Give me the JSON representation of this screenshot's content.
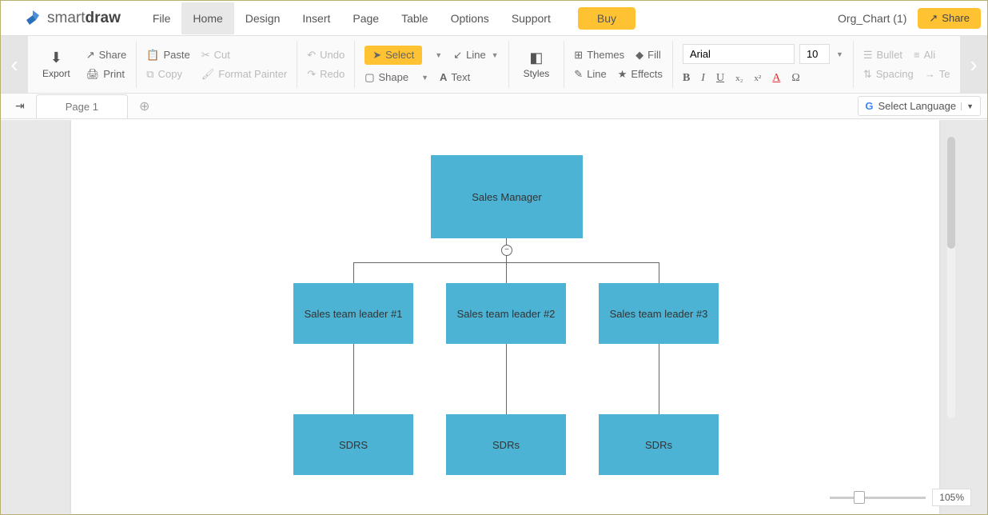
{
  "header": {
    "logo_text_light": "smart",
    "logo_text_bold": "draw",
    "menu": [
      "File",
      "Home",
      "Design",
      "Insert",
      "Page",
      "Table",
      "Options",
      "Support"
    ],
    "active_menu_index": 1,
    "buy_label": "Buy",
    "doc_name": "Org_Chart (1)",
    "share_label": "Share"
  },
  "ribbon": {
    "export_label": "Export",
    "share_label": "Share",
    "print_label": "Print",
    "paste_label": "Paste",
    "copy_label": "Copy",
    "cut_label": "Cut",
    "format_painter_label": "Format Painter",
    "undo_label": "Undo",
    "redo_label": "Redo",
    "select_label": "Select",
    "shape_label": "Shape",
    "line_label": "Line",
    "text_label": "Text",
    "styles_label": "Styles",
    "themes_label": "Themes",
    "fill_label": "Fill",
    "line2_label": "Line",
    "effects_label": "Effects",
    "font_name": "Arial",
    "font_size": "10",
    "bullet_label": "Bullet",
    "align_label": "Ali",
    "spacing_label": "Spacing",
    "te_label": "Te"
  },
  "pagebar": {
    "page_label": "Page 1",
    "lang_label": "Select Language"
  },
  "chart_data": {
    "type": "org-chart",
    "nodes": [
      {
        "id": "root",
        "label": "Sales Manager",
        "level": 0
      },
      {
        "id": "tl1",
        "label": "Sales team leader #1",
        "level": 1
      },
      {
        "id": "tl2",
        "label": "Sales team leader #2",
        "level": 1
      },
      {
        "id": "tl3",
        "label": "Sales team leader #3",
        "level": 1
      },
      {
        "id": "sdr1",
        "label": "SDRS",
        "level": 2
      },
      {
        "id": "sdr2",
        "label": "SDRs",
        "level": 2
      },
      {
        "id": "sdr3",
        "label": "SDRs",
        "level": 2
      }
    ],
    "edges": [
      [
        "root",
        "tl1"
      ],
      [
        "root",
        "tl2"
      ],
      [
        "root",
        "tl3"
      ],
      [
        "tl1",
        "sdr1"
      ],
      [
        "tl2",
        "sdr2"
      ],
      [
        "tl3",
        "sdr3"
      ]
    ]
  },
  "zoom": {
    "value": "105%"
  }
}
